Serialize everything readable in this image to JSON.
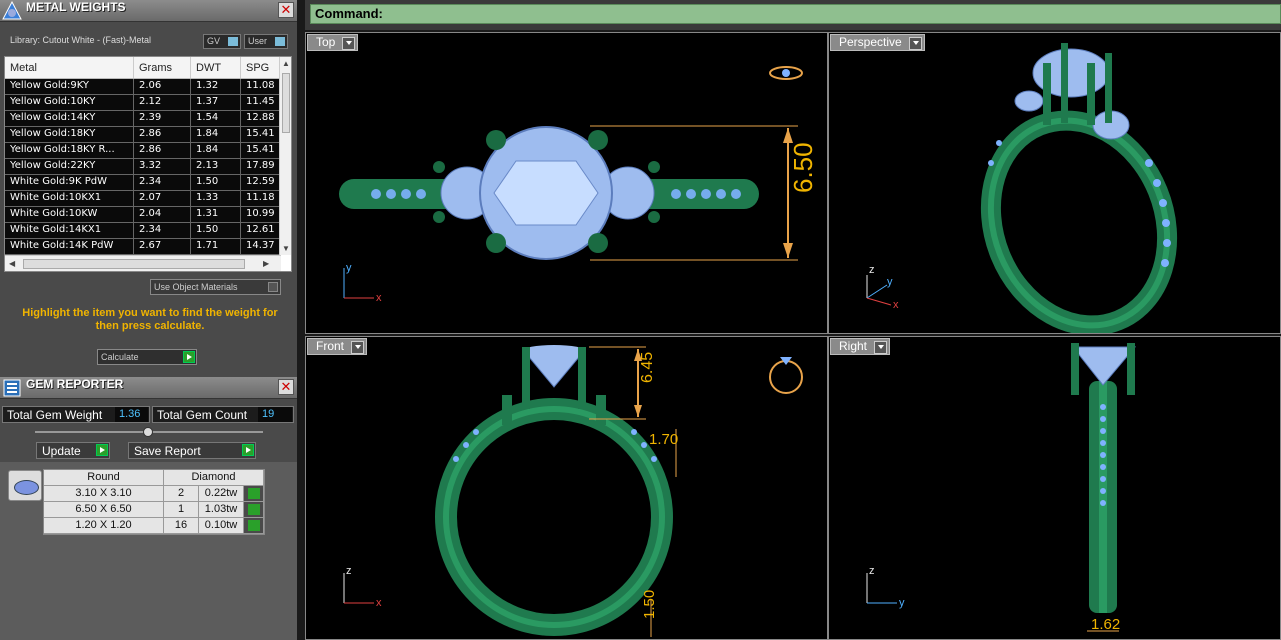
{
  "metal_weights": {
    "title": "METAL WEIGHTS",
    "library": "Library: Cutout White - (Fast)-Metal",
    "gv": "GV",
    "user": "User",
    "columns": [
      "Metal",
      "Grams",
      "DWT",
      "SPG"
    ],
    "rows": [
      [
        "Yellow Gold:9KY",
        "2.06",
        "1.32",
        "11.08"
      ],
      [
        "Yellow Gold:10KY",
        "2.12",
        "1.37",
        "11.45"
      ],
      [
        "Yellow Gold:14KY",
        "2.39",
        "1.54",
        "12.88"
      ],
      [
        "Yellow Gold:18KY",
        "2.86",
        "1.84",
        "15.41"
      ],
      [
        "Yellow Gold:18KY R...",
        "2.86",
        "1.84",
        "15.41"
      ],
      [
        "Yellow Gold:22KY",
        "3.32",
        "2.13",
        "17.89"
      ],
      [
        "White Gold:9K PdW",
        "2.34",
        "1.50",
        "12.59"
      ],
      [
        "White Gold:10KX1",
        "2.07",
        "1.33",
        "11.18"
      ],
      [
        "White Gold:10KW",
        "2.04",
        "1.31",
        "10.99"
      ],
      [
        "White Gold:14KX1",
        "2.34",
        "1.50",
        "12.61"
      ],
      [
        "White Gold:14K PdW",
        "2.67",
        "1.71",
        "14.37"
      ]
    ],
    "use_object_materials": "Use Object Materials",
    "hint": "Highlight the item you want to find the weight for then press calculate.",
    "calculate": "Calculate"
  },
  "gem_reporter": {
    "title": "GEM REPORTER",
    "total_weight_label": "Total Gem Weight",
    "total_weight": "1.36",
    "total_count_label": "Total Gem Count",
    "total_count": "19",
    "update": "Update",
    "save_report": "Save Report",
    "header": [
      "Round",
      "Diamond"
    ],
    "rows": [
      [
        "3.10 X 3.10",
        "2",
        "0.22tw"
      ],
      [
        "6.50 X 6.50",
        "1",
        "1.03tw"
      ],
      [
        "1.20 X 1.20",
        "16",
        "0.10tw"
      ]
    ]
  },
  "command": {
    "label": "Command:"
  },
  "viewports": {
    "top": {
      "label": "Top",
      "dim": "6.50"
    },
    "perspective": {
      "label": "Perspective"
    },
    "front": {
      "label": "Front",
      "dim1": "6.45",
      "dim2": "1.70",
      "dim3": "1.50"
    },
    "right": {
      "label": "Right",
      "dim": "1.62"
    }
  },
  "axes": {
    "x": "x",
    "y": "y",
    "z": "z"
  }
}
